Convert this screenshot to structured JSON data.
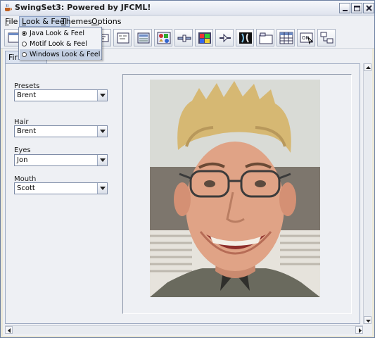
{
  "window": {
    "title": "SwingSet3: Powered by JFCML!"
  },
  "menubar": {
    "items": [
      {
        "label": "File",
        "mnemonic": "F",
        "rest": "ile"
      },
      {
        "label": "Look & Feel",
        "mnemonic": "L",
        "rest": "ook & Feel"
      },
      {
        "label": "Themes",
        "mnemonic": "T",
        "rest": "hemes"
      },
      {
        "label": "Options",
        "mnemonic": "O",
        "rest": "ptions"
      }
    ],
    "open_menu": "Look & Feel"
  },
  "laf_menu": {
    "items": [
      {
        "label": "Java Look & Feel",
        "selected_radio": true
      },
      {
        "label": "Motif Look & Feel",
        "selected_radio": false
      },
      {
        "label": "Windows Look & Feel",
        "selected_radio": false,
        "highlighted": true
      }
    ]
  },
  "toolbar": {
    "buttons": [
      "internal-frame-icon",
      "button-icon",
      "text-field-icon",
      "combobox-icon",
      "list-icon",
      "checkbox-icon",
      "slider-icon",
      "color-chooser-icon",
      "tree-icon",
      "split-pane-icon",
      "tabbed-pane-icon",
      "table-icon",
      "option-pane-icon",
      "layout-icon"
    ]
  },
  "tab": {
    "label": "First"
  },
  "form": {
    "presets": {
      "label": "Presets",
      "value": "Brent"
    },
    "hair": {
      "label": "Hair",
      "value": "Brent"
    },
    "eyes": {
      "label": "Eyes",
      "value": "Jon"
    },
    "mouth": {
      "label": "Mouth",
      "value": "Scott"
    }
  },
  "image": {
    "subject": "composite-face-photo"
  },
  "colors": {
    "chrome": "#eef0f4",
    "selection": "#c3cfe2",
    "border": "#7e8ca7"
  }
}
